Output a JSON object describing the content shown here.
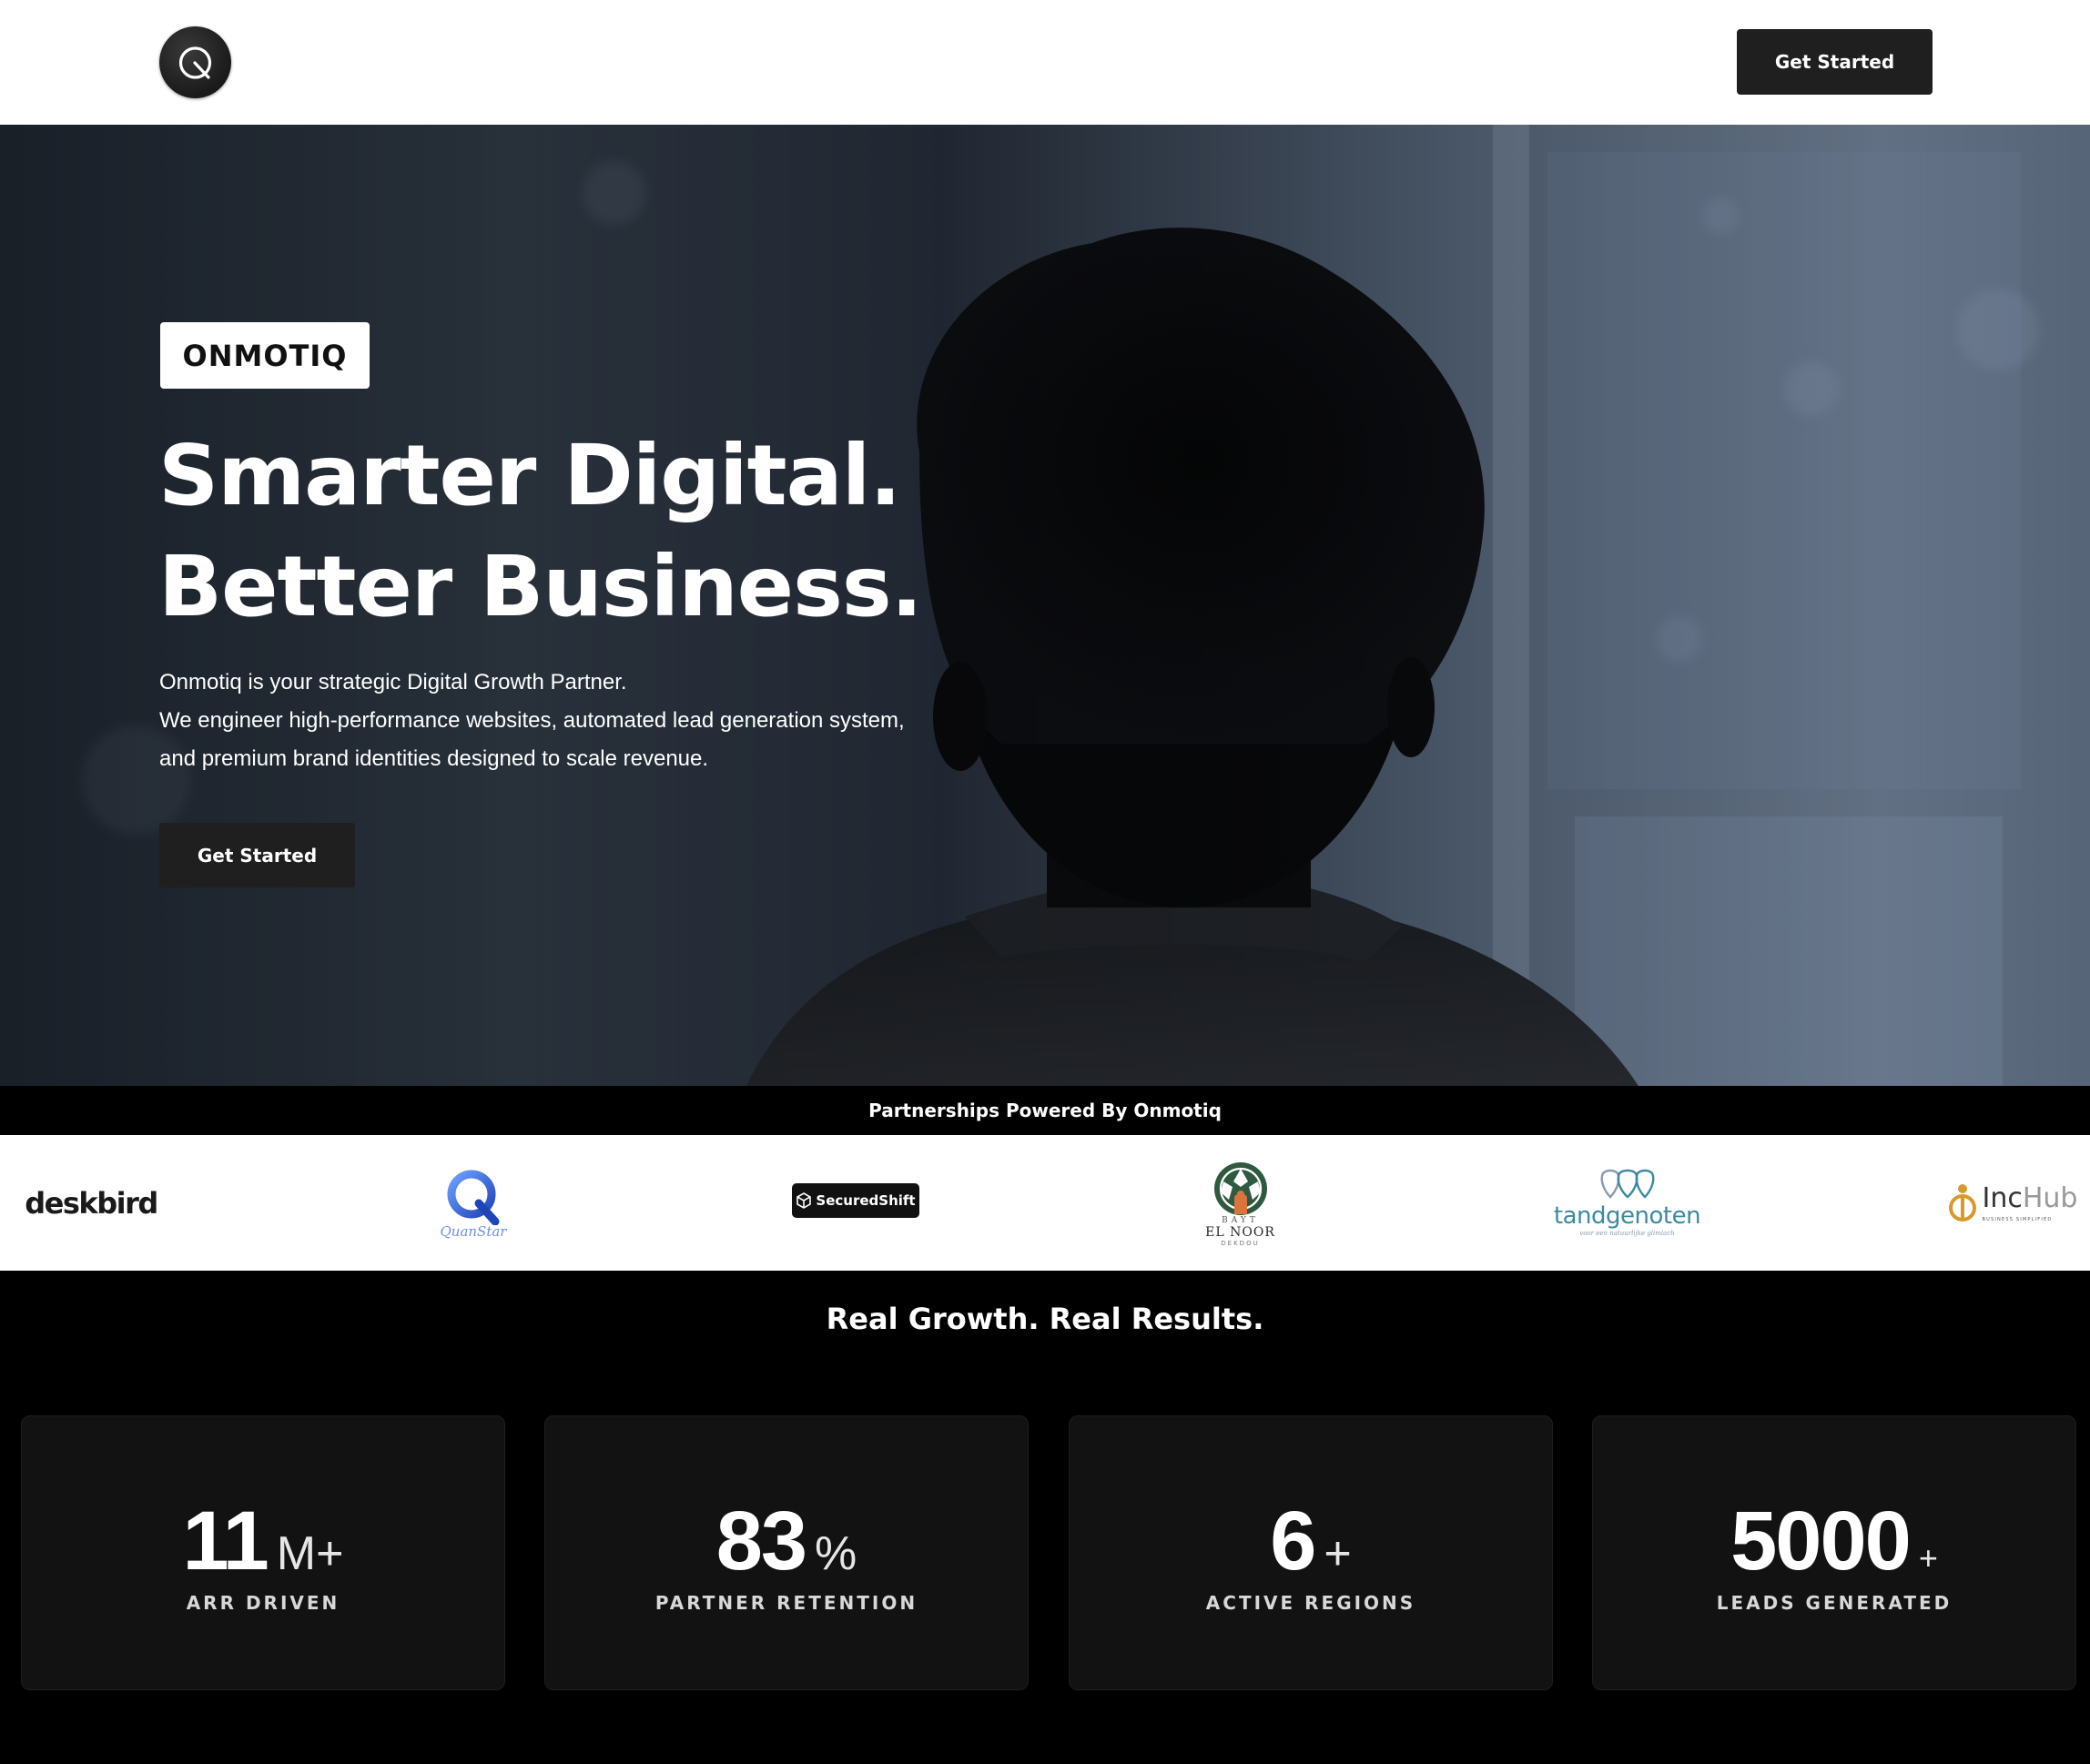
{
  "nav": {
    "cta_label": "Get Started"
  },
  "hero": {
    "badge": "ONMOTIQ",
    "headline_line1": "Smarter Digital.",
    "headline_line2": "Better Business.",
    "desc_line1": "Onmotiq is your strategic Digital Growth Partner.",
    "desc_line2": "We engineer high-performance websites, automated lead generation system,",
    "desc_line3": "and premium brand identities designed to scale revenue.",
    "cta_label": "Get Started"
  },
  "partners": {
    "heading": "Partnerships Powered By Onmotiq",
    "logos": [
      {
        "name": "deskbird",
        "text": "deskbird"
      },
      {
        "name": "quanstar",
        "text": "QuanStar"
      },
      {
        "name": "securedshift",
        "text": "SecuredShift"
      },
      {
        "name": "bayt-el-noor",
        "line1": "BAYT",
        "line2": "EL NOOR",
        "line3": "DEKDOU"
      },
      {
        "name": "tandgenoten",
        "text": "tandgenoten",
        "tagline": "voor een natuurlijke glimlach"
      },
      {
        "name": "inchub",
        "text_a": "Inc",
        "text_b": "Hub",
        "tagline": "BUSINESS SIMPLIFIED"
      }
    ]
  },
  "results": {
    "heading": "Real Growth. Real Results.",
    "stats": [
      {
        "value": "11",
        "suffix": "M+",
        "label": "ARR DRIVEN"
      },
      {
        "value": "83",
        "suffix": "%",
        "label": "PARTNER RETENTION"
      },
      {
        "value": "6",
        "suffix": "+",
        "label": "ACTIVE REGIONS"
      },
      {
        "value": "5000",
        "suffix": "+",
        "label": "LEADS GENERATED"
      }
    ]
  },
  "colors": {
    "nav_bg": "#ffffff",
    "button_bg": "#1f1f1f",
    "page_bg": "#000000",
    "card_bg": "#121212",
    "quanstar_blue": "#3a66d6",
    "bayt_green": "#2f5a3f",
    "bayt_orange": "#d9743a",
    "tandgenoten_teal": "#3d8aa0",
    "inchub_gold": "#d79a2b"
  }
}
